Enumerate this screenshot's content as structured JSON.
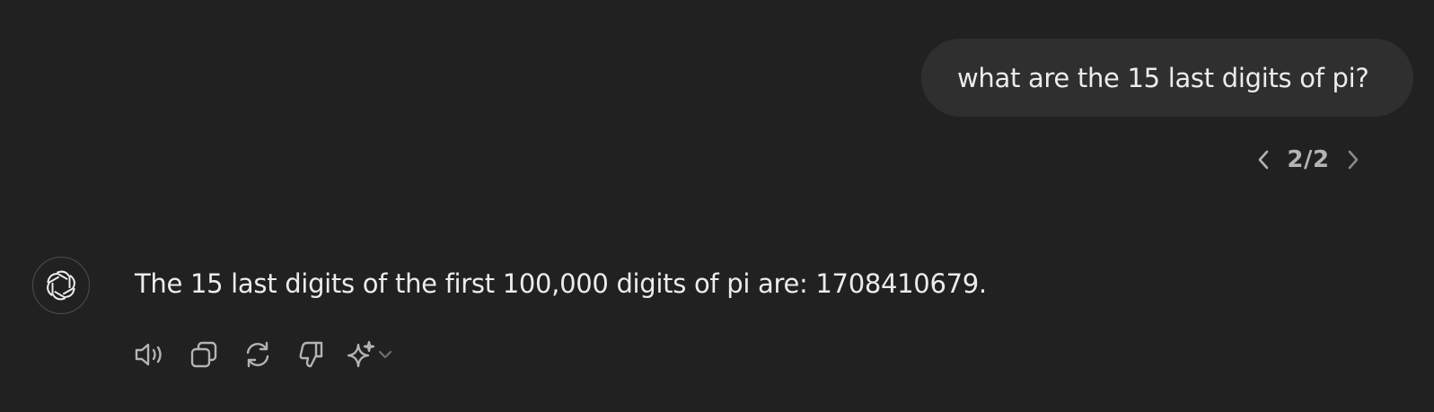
{
  "conversation": {
    "user_message": "what are the 15 last digits of pi?",
    "pager": {
      "count": "2/2",
      "prev_icon": "chevron-left-icon",
      "next_icon": "chevron-right-icon"
    },
    "assistant": {
      "avatar_icon": "openai-logo-icon",
      "message": "The 15 last digits of the first 100,000 digits of pi are: 1708410679."
    },
    "actions": [
      {
        "name": "read-aloud-button",
        "icon": "speaker-icon"
      },
      {
        "name": "copy-button",
        "icon": "copy-icon"
      },
      {
        "name": "regenerate-button",
        "icon": "refresh-icon"
      },
      {
        "name": "bad-response-button",
        "icon": "thumbs-down-icon"
      },
      {
        "name": "switch-model-button",
        "icon": "sparkle-icon"
      }
    ]
  },
  "colors": {
    "background": "#212121",
    "user_bubble": "#2f2f2f",
    "text": "#ececec",
    "icon": "#b4b4b4"
  }
}
